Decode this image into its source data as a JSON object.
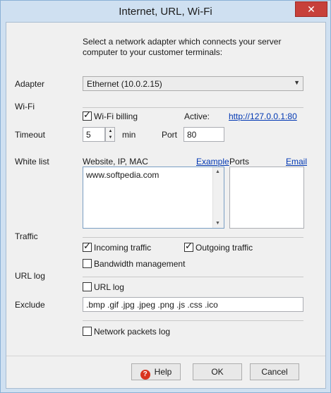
{
  "window": {
    "title": "Internet, URL, Wi-Fi",
    "close_glyph": "✕"
  },
  "intro_text": "Select a network adapter which connects your server computer to your customer terminals:",
  "adapter": {
    "label": "Adapter",
    "selected": "Ethernet (10.0.2.15)"
  },
  "wifi": {
    "section_label": "Wi-Fi",
    "billing_label": "Wi-Fi billing",
    "billing_checked": true,
    "active_label": "Active:",
    "active_url": "http://127.0.0.1:80",
    "timeout_label": "Timeout",
    "timeout_value": "5",
    "timeout_unit": "min",
    "port_label": "Port",
    "port_value": "80"
  },
  "whitelist": {
    "label": "White list",
    "sites_header": "Website, IP, MAC",
    "example_link": "Example",
    "ports_header": "Ports",
    "email_link": "Email",
    "sites_value": "www.softpedia.com",
    "ports_value": ""
  },
  "traffic": {
    "section_label": "Traffic",
    "incoming_label": "Incoming traffic",
    "incoming_checked": true,
    "outgoing_label": "Outgoing traffic",
    "outgoing_checked": true,
    "bandwidth_label": "Bandwidth management",
    "bandwidth_checked": false
  },
  "urllog": {
    "section_label": "URL log",
    "url_log_label": "URL log",
    "url_log_checked": false,
    "exclude_label": "Exclude",
    "exclude_value": ".bmp .gif .jpg .jpeg .png .js .css .ico",
    "packets_label": "Network packets log",
    "packets_checked": false
  },
  "buttons": {
    "help": "Help",
    "ok": "OK",
    "cancel": "Cancel"
  },
  "colors": {
    "link": "#0037b3",
    "close_button": "#c7403a",
    "frame": "#cfe0f1"
  }
}
